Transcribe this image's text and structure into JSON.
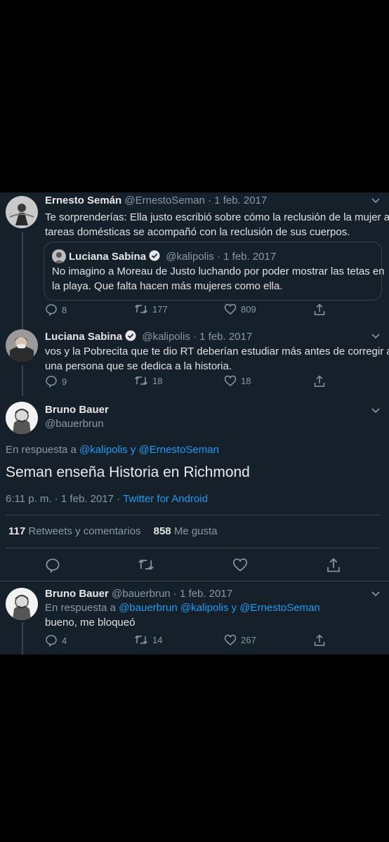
{
  "tweet1": {
    "name": "Ernesto Semán",
    "handle": "@ErnestoSeman",
    "date": "· 1 feb. 2017",
    "text_line1": "Te sorprenderías: Ella justo escribió sobre cómo la reclusión de la mujer a",
    "text_line2": "tareas domésticas se acompañó con la reclusión de sus cuerpos.",
    "quote": {
      "name": "Luciana Sabina",
      "handle": "@kalipolis",
      "date": "· 1 feb. 2017",
      "text_line1": "No imagino a Moreau de Justo luchando por poder mostrar las tetas en",
      "text_line2": "la playa. Que falta hacen más mujeres como ella."
    },
    "replies": "8",
    "retweets": "177",
    "likes": "809"
  },
  "tweet2": {
    "name": "Luciana Sabina",
    "handle": "@kalipolis",
    "date": "· 1 feb. 2017",
    "text_line1": "vos y la Pobrecita que te dio RT deberían estudiar más antes de corregir a",
    "text_line2": "una persona que se dedica a la historia.",
    "replies": "9",
    "retweets": "18",
    "likes": "18"
  },
  "main": {
    "name": "Bruno Bauer",
    "handle": "@bauerbrun",
    "reply_prefix": "En respuesta a",
    "reply_to": "@kalipolis y @ErnestoSeman",
    "text": "Seman enseña Historia en Richmond",
    "time": "6:11 p. m. · 1 feb. 2017 ·",
    "client": "Twitter for Android",
    "retweets_count": "117",
    "retweets_label": "Retweets y comentarios",
    "likes_count": "858",
    "likes_label": "Me gusta"
  },
  "tweet4": {
    "name": "Bruno Bauer",
    "handle": "@bauerbrun",
    "date": "· 1 feb. 2017",
    "reply_prefix": "En respuesta a",
    "reply_to": "@bauerbrun @kalipolis y @ErnestoSeman",
    "text": "bueno, me bloqueó",
    "replies": "4",
    "retweets": "14",
    "likes": "267"
  },
  "colors": {
    "background": "#15202b",
    "link": "#1d9bf0",
    "muted": "#8899a6",
    "border": "#38444d"
  }
}
